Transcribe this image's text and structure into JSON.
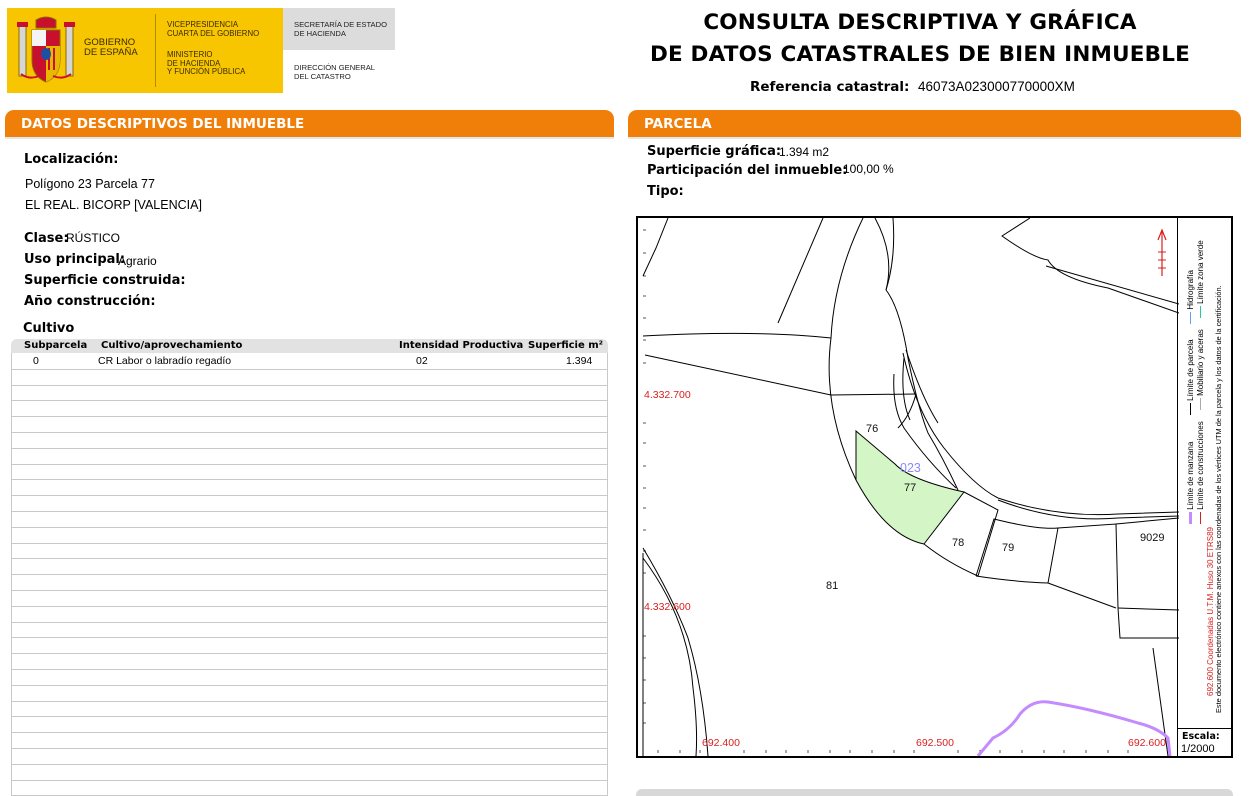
{
  "header": {
    "gobierno": [
      "GOBIERNO",
      "DE ESPAÑA"
    ],
    "vicepresidencia": [
      "VICEPRESIDENCIA",
      "CUARTA DEL GOBIERNO"
    ],
    "ministerio": [
      "MINISTERIO",
      "DE HACIENDA",
      "Y FUNCIÓN PÚBLICA"
    ],
    "secretaria": [
      "SECRETARÍA DE ESTADO",
      "DE HACIENDA"
    ],
    "direccion": [
      "DIRECCIÓN GENERAL",
      "DEL CATASTRO"
    ],
    "title_line1": "CONSULTA DESCRIPTIVA Y GRÁFICA",
    "title_line2": "DE DATOS CATASTRALES DE BIEN INMUEBLE",
    "ref_label": "Referencia catastral:",
    "ref_value": "46073A023000770000XM"
  },
  "left": {
    "section_title": "DATOS DESCRIPTIVOS DEL INMUEBLE",
    "localizacion_label": "Localización:",
    "localizacion_line1": "Polígono 23 Parcela 77",
    "localizacion_line2": "EL REAL. BICORP [VALENCIA]",
    "clase_label": "Clase:",
    "clase_value": "RÚSTICO",
    "uso_label": "Uso principal:",
    "uso_value": "Agrario",
    "superficie_label": "Superficie construida:",
    "anio_label": "Año construcción:",
    "cultivo_title": "Cultivo",
    "table": {
      "headers": [
        "Subparcela",
        "Cultivo/aprovechamiento",
        "Intensidad Productiva",
        "Superficie m²"
      ],
      "rows": [
        [
          "0",
          "CR Labor o labradío regadío",
          "02",
          "1.394"
        ]
      ]
    }
  },
  "right": {
    "section_title": "PARCELA",
    "sup_label": "Superficie gráfica:",
    "sup_value": "1.394 m2",
    "part_label": "Participación del inmueble:",
    "part_value": "100,00 %",
    "tipo_label": "Tipo:",
    "map": {
      "coords_y": [
        "4.332.700",
        "4.332.600"
      ],
      "coords_x": [
        "692.400",
        "692.500",
        "692.600"
      ],
      "parcel_labels": [
        "76",
        "77",
        "78",
        "79",
        "81",
        "9029"
      ],
      "subparcel_label": "023",
      "highlight_color": "#d4f5c6",
      "escala_label": "Escala:",
      "escala_value": "1/2000",
      "legend_col1_a": "Límite de manzana",
      "legend_col1_b": "Límite de parcela",
      "legend_col1_c": "Hidrografía",
      "legend_col2_a": "Límite de construcciones",
      "legend_col2_b": "Mobiliario y aceras",
      "legend_col2_c": "Límite zona verde",
      "legend_col3": "692.600 Coordenadas U.T.M. Huso 30 ETRS89",
      "legend_col4": "Este documento electrónico contiene anexos con las coordenadas de los vértices UTM de la parcela y los datos de la certificación."
    }
  }
}
